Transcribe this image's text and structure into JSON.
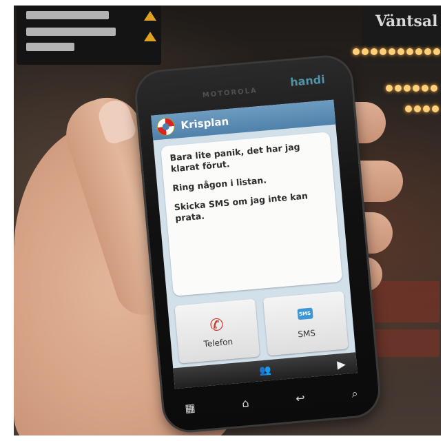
{
  "background": {
    "sign_right_text": "Väntsal"
  },
  "phone": {
    "brand": "MOTOROLA",
    "badge": "handi",
    "app": {
      "title": "Krisplan",
      "messages": [
        "Bara lite panik, det har jag klarat förut.",
        "Ring någon i listan.",
        "Skicka SMS om jag inte kan prata."
      ],
      "buttons": {
        "phone_label": "Telefon",
        "sms_label": "SMS",
        "sms_icon_text": "SMS"
      },
      "icons": {
        "app": "lifebuoy-icon",
        "phone": "phone-handset-icon",
        "sms": "sms-bubble-icon",
        "contacts": "contacts-icon",
        "next": "play-icon"
      }
    },
    "hardware_keys": [
      "menu-icon",
      "home-icon",
      "back-icon",
      "search-icon"
    ]
  },
  "colors": {
    "titlebar": "#4f81ab",
    "screen_bg": "#d2e0ea",
    "phone_icon": "#c8382b",
    "sms_icon": "#3d97d4"
  }
}
